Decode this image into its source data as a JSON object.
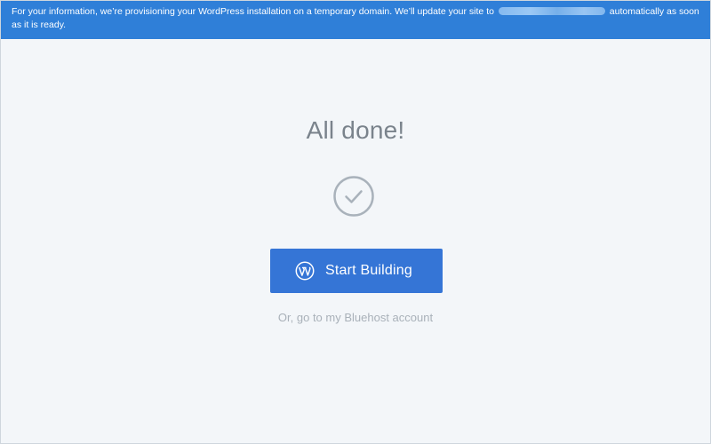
{
  "banner": {
    "text_before": "For your information, we’re provisioning your WordPress installation on a temporary domain. We’ll update your site to",
    "text_after": "automatically as soon as it is ready.",
    "background_color": "#2f7fd8"
  },
  "main": {
    "title": "All done!",
    "status_icon": "check-circle-icon",
    "primary_button": {
      "label": "Start Building",
      "icon": "wordpress-icon",
      "color": "#3575d6"
    },
    "secondary_link": "Or, go to my Bluehost account"
  }
}
